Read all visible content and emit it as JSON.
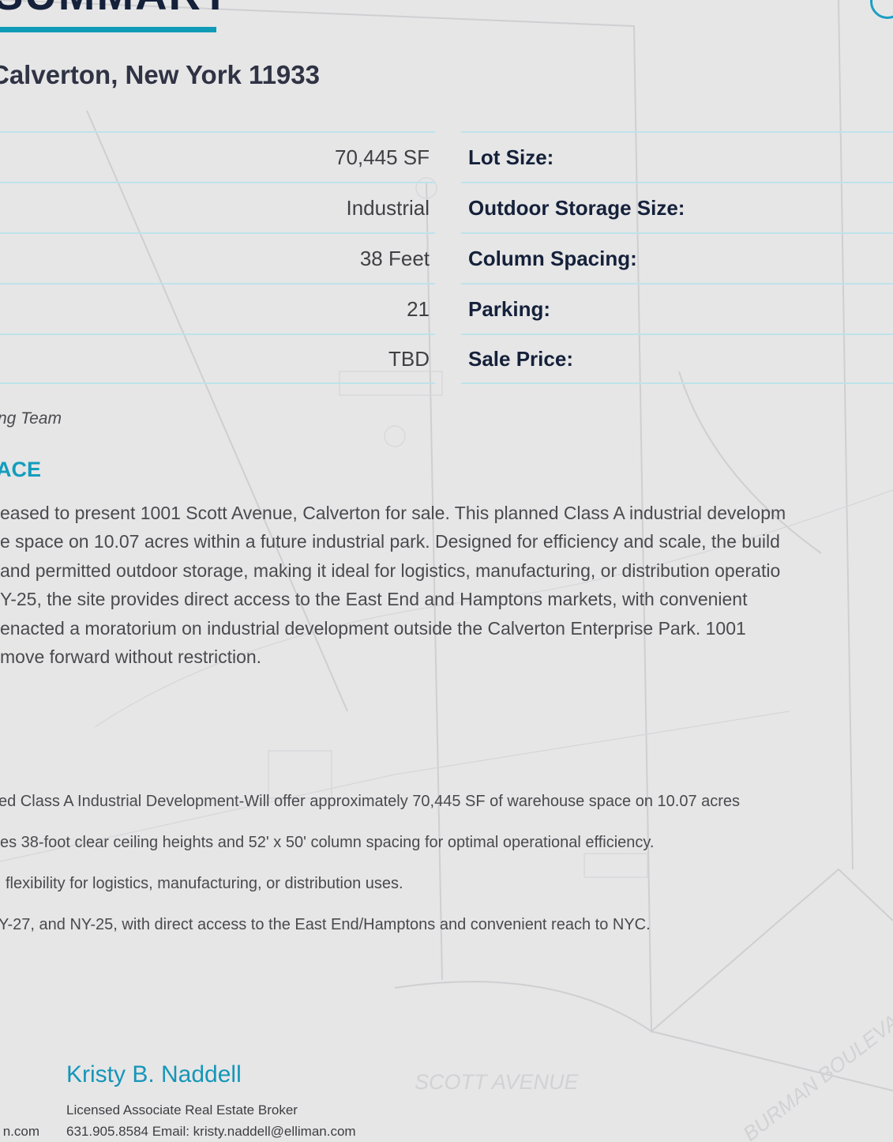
{
  "header": {
    "title": "SUMMARY",
    "address": "Calverton, New York 11933"
  },
  "left_table": {
    "rows": [
      "70,445 SF",
      "Industrial",
      "38 Feet",
      "21",
      "TBD"
    ]
  },
  "right_table": {
    "rows": [
      "Lot Size:",
      "Outdoor Storage Size:",
      "Column Spacing:",
      "Parking:",
      "Sale Price:"
    ]
  },
  "listing_team": "sting Team",
  "section_heading": "ACE",
  "overview_lines": [
    "eased to present 1001 Scott Avenue, Calverton for sale. This planned Class A industrial developm",
    "e space on 10.07 acres within a future industrial park. Designed for efficiency and scale, the build",
    "and permitted outdoor storage, making it ideal for logistics, manufacturing, or distribution operatio",
    "Y-25, the site provides direct access to the East End and Hamptons markets, with convenient",
    "enacted a moratorium on industrial development outside the Calverton Enterprise Park. 1001",
    "move forward without restriction."
  ],
  "bullets": [
    "ed Class A Industrial Development-Will offer approximately 70,445 SF of warehouse space on 10.07 acres",
    "es 38-foot clear ceiling heights and 52' x 50' column spacing for optimal operational efficiency.",
    "flexibility for logistics, manufacturing, or distribution uses.",
    "Y-27, and NY-25, with direct access to the East End/Hamptons and convenient reach to NYC."
  ],
  "contact": {
    "other_email_tail": "n.com",
    "agent_name": "Kristy B. Naddell",
    "agent_title": "Licensed Associate Real Estate Broker",
    "agent_contact": "631.905.8584 Email: kristy.naddell@elliman.com"
  },
  "map_labels": {
    "street_bottom": "SCOTT AVENUE",
    "street_right": "BURMAN BOULEVARD"
  },
  "colors": {
    "accent": "#0f9bb7",
    "heading_dark": "#15213a",
    "background": "#e6e6e7"
  }
}
